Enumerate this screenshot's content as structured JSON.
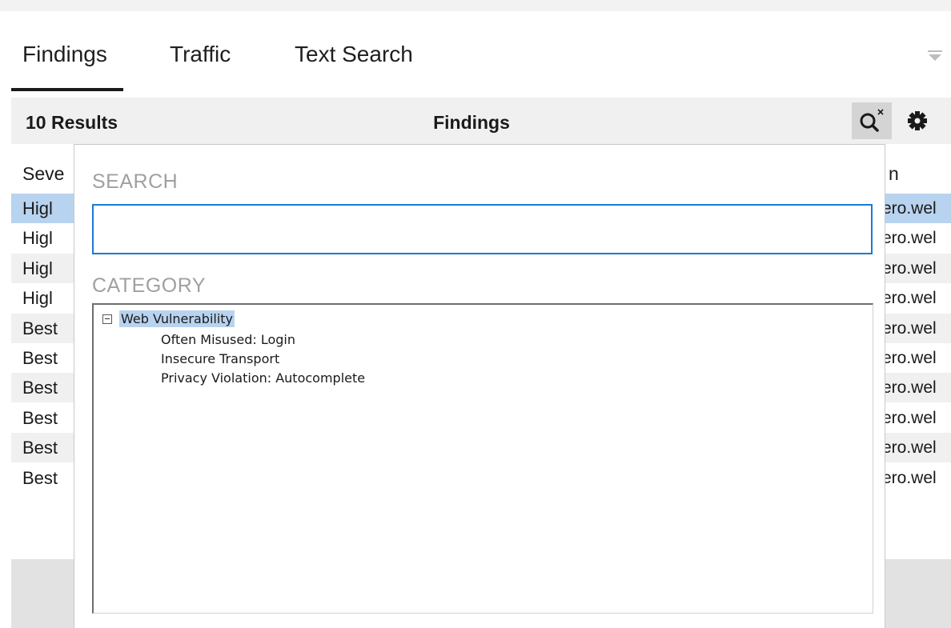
{
  "tabs": [
    {
      "label": "Findings",
      "active": true
    },
    {
      "label": "Traffic",
      "active": false
    },
    {
      "label": "Text Search",
      "active": false
    }
  ],
  "header": {
    "results_count": "10 Results",
    "title": "Findings"
  },
  "table": {
    "columns": [
      "Seve",
      "n"
    ],
    "rows": [
      {
        "severity": "Higl",
        "location": "ero.wel",
        "selected": true
      },
      {
        "severity": "Higl",
        "location": "ero.wel",
        "selected": false
      },
      {
        "severity": "Higl",
        "location": "ero.wel",
        "selected": false
      },
      {
        "severity": "Higl",
        "location": "ero.wel",
        "selected": false
      },
      {
        "severity": "Best",
        "location": "ero.wel",
        "selected": false
      },
      {
        "severity": "Best",
        "location": "ero.wel",
        "selected": false
      },
      {
        "severity": "Best",
        "location": "ero.wel",
        "selected": false
      },
      {
        "severity": "Best",
        "location": "ero.wel",
        "selected": false
      },
      {
        "severity": "Best",
        "location": "ero.wel",
        "selected": false
      },
      {
        "severity": "Best",
        "location": "ero.wel",
        "selected": false
      }
    ]
  },
  "popup": {
    "search_label": "SEARCH",
    "search_value": "",
    "category_label": "CATEGORY",
    "tree": {
      "root": "Web Vulnerability",
      "expanded": true,
      "children": [
        "Often Misused: Login",
        "Insecure Transport",
        "Privacy Violation: Autocomplete"
      ]
    }
  },
  "icons": {
    "overflow": "overflow-funnel-icon",
    "search": "search-clear-icon",
    "settings": "gear-icon"
  },
  "colors": {
    "selected_row": "#b8d3ef",
    "input_focus": "#1e78d4",
    "header_bg": "#f0f0f0"
  }
}
